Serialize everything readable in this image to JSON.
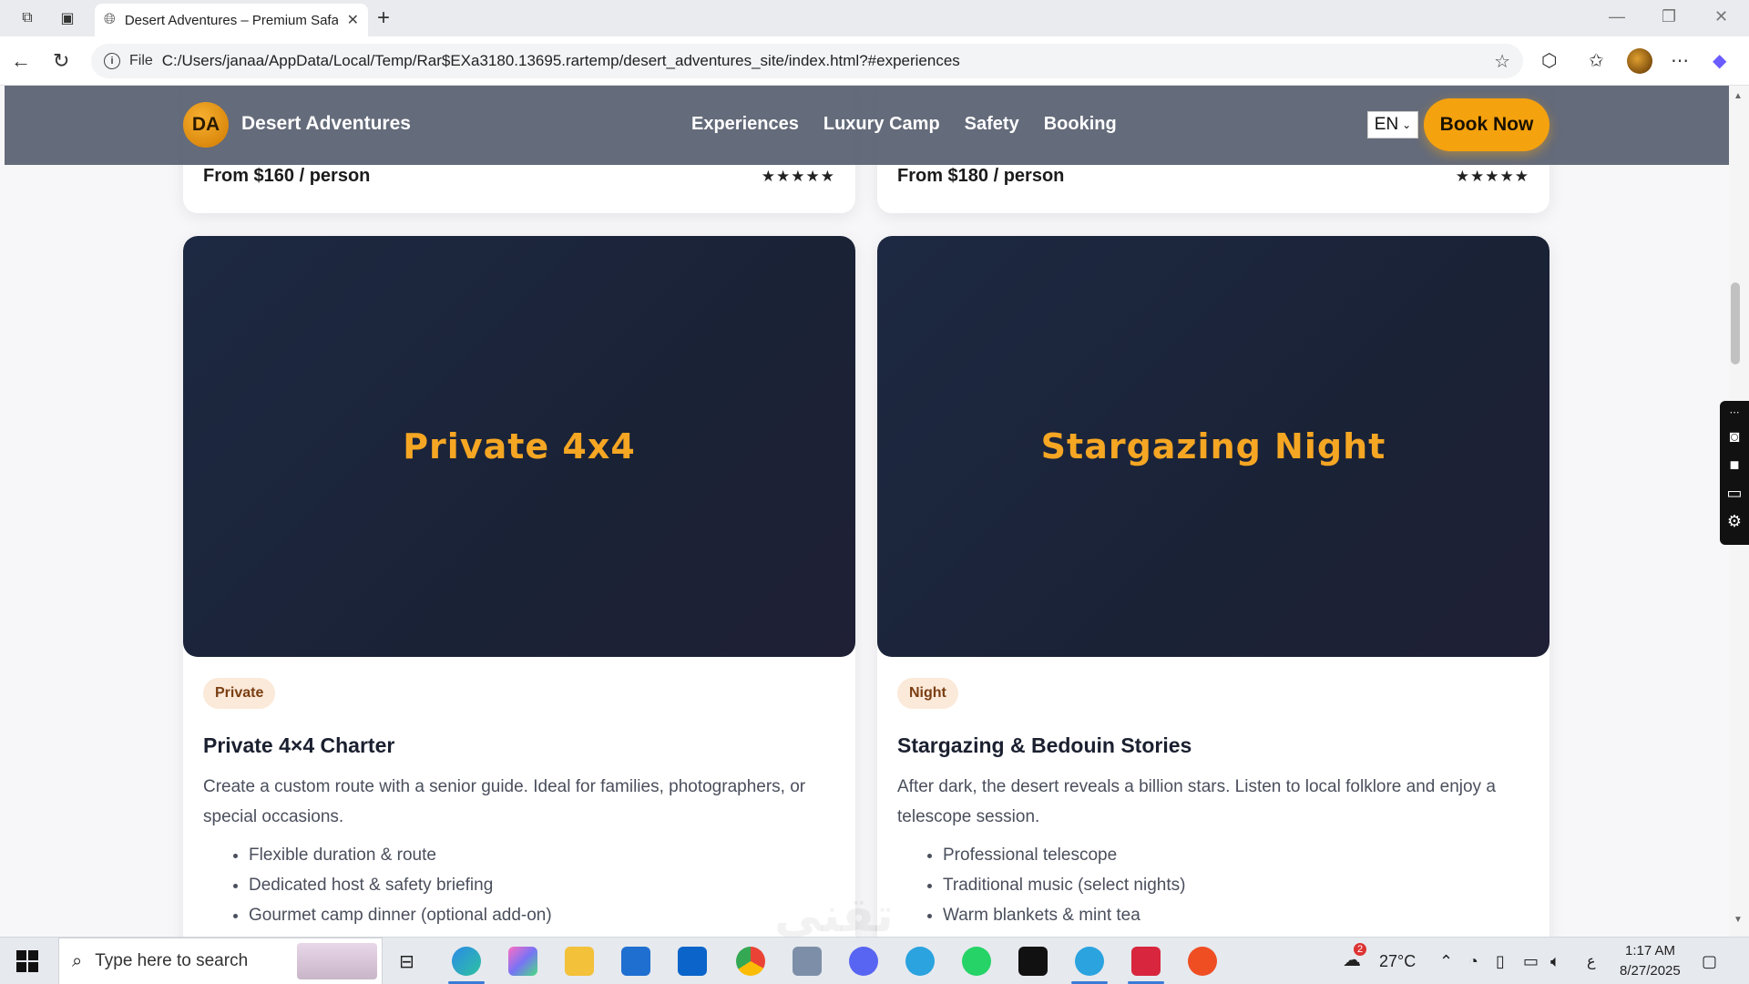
{
  "browser": {
    "tab_title": "Desert Adventures – Premium Safari",
    "file_label": "File",
    "url": "C:/Users/janaa/AppData/Local/Temp/Rar$EXa3180.13695.rartemp/desert_adventures_site/index.html?#experiences"
  },
  "site": {
    "logo_initials": "DA",
    "brand_name": "Desert Adventures",
    "nav": [
      "Experiences",
      "Luxury Camp",
      "Safety",
      "Booking"
    ],
    "language": "EN",
    "cta": "Book Now"
  },
  "cards_top": [
    {
      "price": "From $160 / person",
      "rating": "★★★★★"
    },
    {
      "price": "From $180 / person",
      "rating": "★★★★★"
    }
  ],
  "cards": [
    {
      "media_title": "Private 4x4",
      "badge": "Private",
      "title": "Private 4×4 Charter",
      "description": "Create a custom route with a senior guide. Ideal for families, photographers, or special occasions.",
      "features": [
        "Flexible duration & route",
        "Dedicated host & safety briefing",
        "Gourmet camp dinner (optional add-on)"
      ]
    },
    {
      "media_title": "Stargazing Night",
      "badge": "Night",
      "title": "Stargazing & Bedouin Stories",
      "description": "After dark, the desert reveals a billion stars. Listen to local folklore and enjoy a telescope session.",
      "features": [
        "Professional telescope",
        "Traditional music (select nights)",
        "Warm blankets & mint tea"
      ]
    }
  ],
  "taskbar": {
    "search_placeholder": "Type here to search",
    "weather": "27°C",
    "weather_badge": "2",
    "time": "1:17 AM",
    "date": "8/27/2025",
    "lang_indicator": "ع"
  },
  "colors": {
    "accent": "#f5a20f",
    "media_bg": "#1d2942",
    "badge_bg": "#fbe9d9",
    "header_bg": "#586070"
  }
}
